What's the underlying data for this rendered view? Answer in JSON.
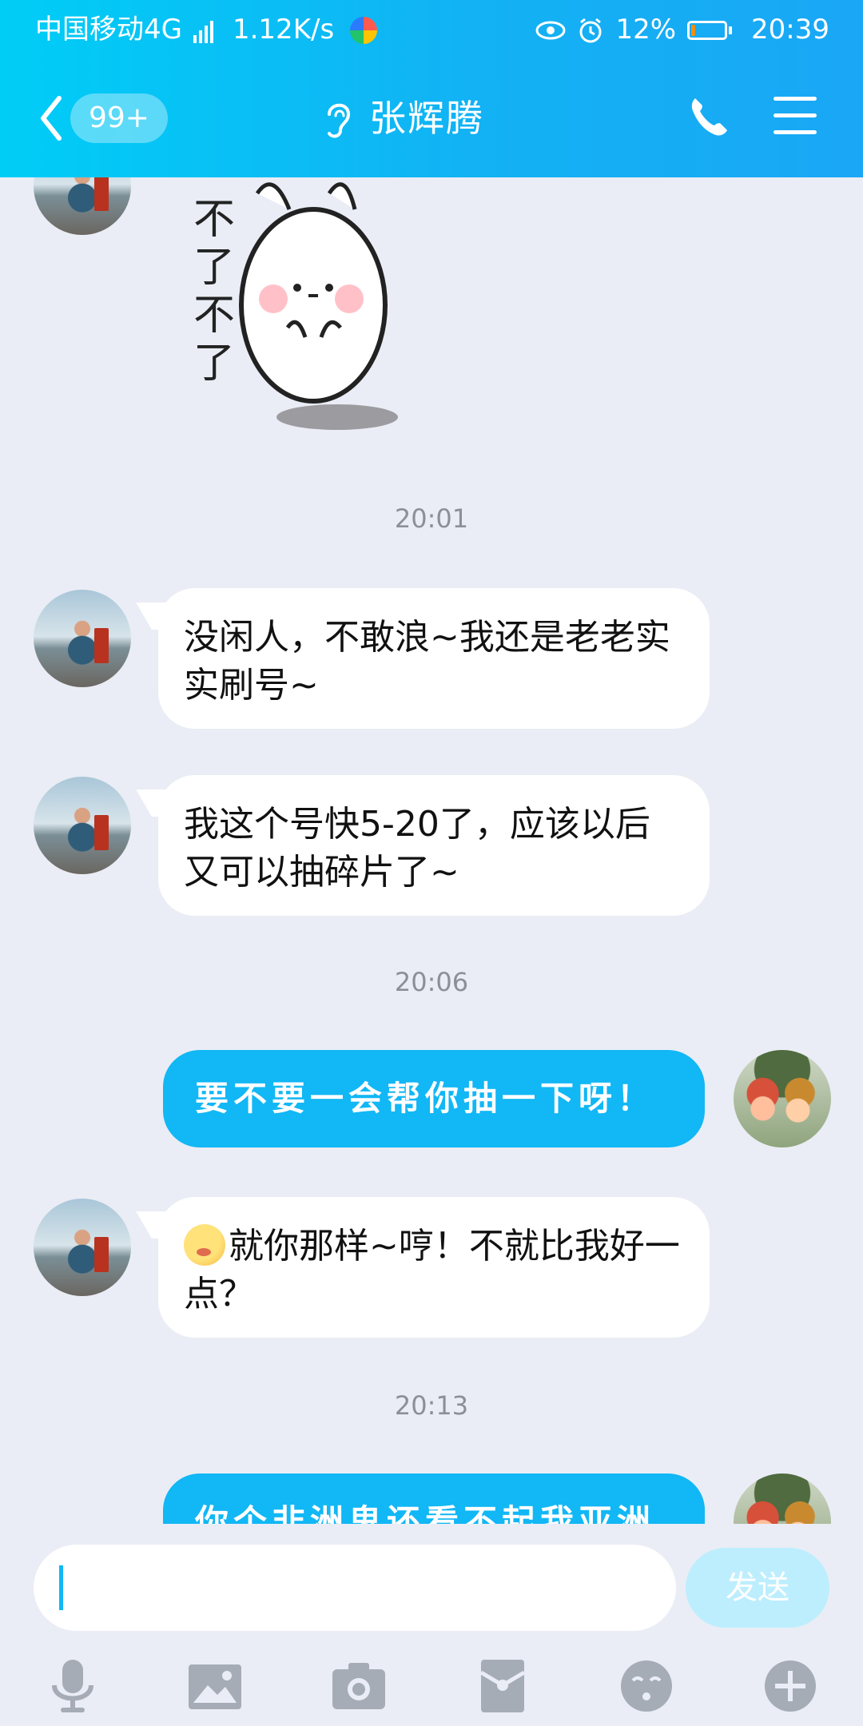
{
  "status_bar": {
    "carrier": "中国移动4G",
    "net_label": "4G",
    "speed": "1.12K/s",
    "battery": "12%",
    "time": "20:39"
  },
  "header": {
    "unread_badge": "99+",
    "title": "张辉腾"
  },
  "sticker_text": "不了不了",
  "messages": [
    {
      "type": "time",
      "text": "20:01"
    },
    {
      "type": "incoming",
      "text": "没闲人，不敢浪~我还是老老实实刷号~"
    },
    {
      "type": "incoming",
      "text": "我这个号快5-20了，应该以后又可以抽碎片了~"
    },
    {
      "type": "time",
      "text": "20:06"
    },
    {
      "type": "outgoing",
      "text": "要不要一会帮你抽一下呀！"
    },
    {
      "type": "incoming",
      "text": "就你那样~哼！不就比我好一点？",
      "emoji": "pouting-face-icon"
    },
    {
      "type": "time",
      "text": "20:13"
    },
    {
      "type": "outgoing",
      "text": "你个非洲鬼还看不起我亚洲"
    }
  ],
  "input": {
    "value": "",
    "send_label": "发送"
  },
  "toolbar": [
    "mic-icon",
    "image-icon",
    "camera-icon",
    "red-packet-icon",
    "emoji-icon",
    "plus-icon"
  ],
  "colors": {
    "header_start": "#00cdf6",
    "header_end": "#1aa7f5",
    "outgoing_bubble": "#12b7f5",
    "background": "#eaedf5",
    "send_button": "#bdeefe"
  }
}
